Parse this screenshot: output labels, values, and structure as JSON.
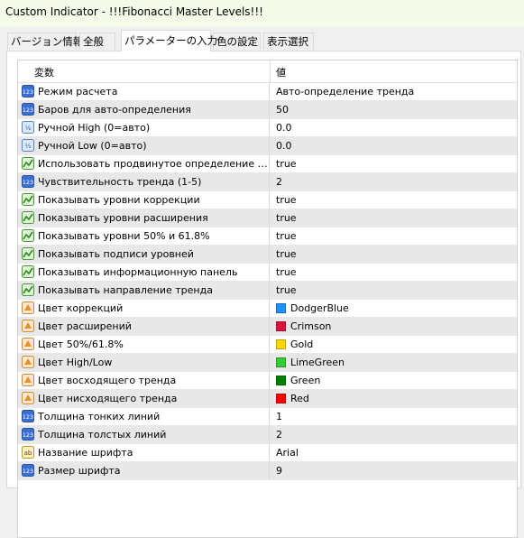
{
  "window": {
    "title": "Custom Indicator - !!!Fibonacci Master Levels!!!"
  },
  "tabs": [
    {
      "label": "バージョン情報"
    },
    {
      "label": "全般"
    },
    {
      "label": "パラメーターの入力"
    },
    {
      "label": "色の設定"
    },
    {
      "label": "表示選択"
    }
  ],
  "active_tab": "パラメーターの入力",
  "grid": {
    "header": {
      "variable": "変数",
      "value": "値"
    },
    "rows": [
      {
        "icon": "enum-icon",
        "name": "Режим расчета",
        "value": "Авто-определение тренда"
      },
      {
        "icon": "int-icon",
        "name": "Баров для авто-определения",
        "value": "50"
      },
      {
        "icon": "double-icon",
        "name": "Ручной High (0=авто)",
        "value": "0.0"
      },
      {
        "icon": "double-icon",
        "name": "Ручной Low (0=авто)",
        "value": "0.0"
      },
      {
        "icon": "bool-icon",
        "name": "Использовать продвинутое определение тр…",
        "value": "true"
      },
      {
        "icon": "int-icon",
        "name": "Чувствительность тренда (1-5)",
        "value": "2"
      },
      {
        "icon": "bool-icon",
        "name": "Показывать уровни коррекции",
        "value": "true"
      },
      {
        "icon": "bool-icon",
        "name": "Показывать уровни расширения",
        "value": "true"
      },
      {
        "icon": "bool-icon",
        "name": "Показывать уровни 50% и 61.8%",
        "value": "true"
      },
      {
        "icon": "bool-icon",
        "name": "Показывать подписи уровней",
        "value": "true"
      },
      {
        "icon": "bool-icon",
        "name": "Показывать информационную панель",
        "value": "true"
      },
      {
        "icon": "bool-icon",
        "name": "Показывать направление тренда",
        "value": "true"
      },
      {
        "icon": "color-icon",
        "name": "Цвет коррекций",
        "value": "DodgerBlue",
        "color": "#1e90ff"
      },
      {
        "icon": "color-icon",
        "name": "Цвет расширений",
        "value": "Crimson",
        "color": "#dc143c"
      },
      {
        "icon": "color-icon",
        "name": "Цвет 50%/61.8%",
        "value": "Gold",
        "color": "#ffd700"
      },
      {
        "icon": "color-icon",
        "name": "Цвет High/Low",
        "value": "LimeGreen",
        "color": "#32cd32"
      },
      {
        "icon": "color-icon",
        "name": "Цвет восходящего тренда",
        "value": "Green",
        "color": "#008000"
      },
      {
        "icon": "color-icon",
        "name": "Цвет нисходящего тренда",
        "value": "Red",
        "color": "#ff0000"
      },
      {
        "icon": "int-icon",
        "name": "Толщина тонких линий",
        "value": "1"
      },
      {
        "icon": "int-icon",
        "name": "Толщина толстых линий",
        "value": "2"
      },
      {
        "icon": "string-icon",
        "name": "Название шрифта",
        "value": "Arial"
      },
      {
        "icon": "int-icon",
        "name": "Размер шрифта",
        "value": "9"
      }
    ]
  }
}
